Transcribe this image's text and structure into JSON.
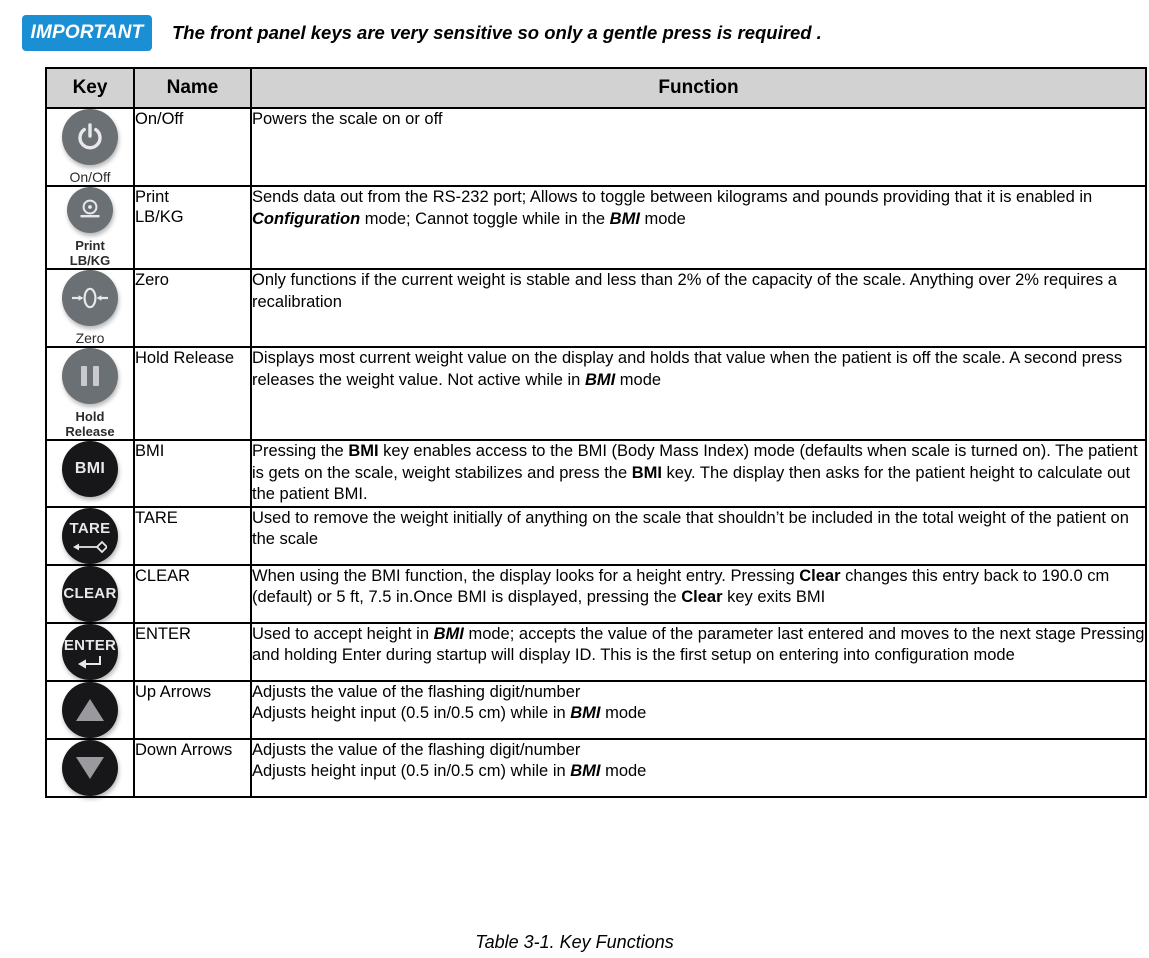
{
  "banner": {
    "tag": "IMPORTANT",
    "text": "The front panel keys are very sensitive so only a gentle press is required ."
  },
  "table": {
    "headers": {
      "key": "Key",
      "name": "Name",
      "function": "Function"
    },
    "rows": [
      {
        "icon": "power-icon",
        "key_label": "On/Off",
        "name": "On/Off",
        "function_parts": [
          {
            "t": "Powers the scale on or off",
            "s": "n"
          }
        ]
      },
      {
        "icon": "print-icon",
        "key_label": "Print\nLB/KG",
        "name": "Print\nLB/KG",
        "function_parts": [
          {
            "t": "Sends data out from the RS-232 port; Allows to toggle between kilograms and pounds providing that it is enabled in ",
            "s": "n"
          },
          {
            "t": "Configuration",
            "s": "bi"
          },
          {
            "t": " mode; Cannot toggle while in the ",
            "s": "n"
          },
          {
            "t": "BMI",
            "s": "bi"
          },
          {
            "t": " mode",
            "s": "n"
          }
        ]
      },
      {
        "icon": "zero-icon",
        "key_label": "Zero",
        "name": "Zero",
        "function_parts": [
          {
            "t": "Only functions if the current weight is stable and less than 2% of the capacity of the scale. Anything over 2% requires a recalibration",
            "s": "n"
          }
        ]
      },
      {
        "icon": "hold-release-icon",
        "key_label": "Hold\nRelease",
        "name": "Hold Release",
        "function_parts": [
          {
            "t": "Displays most current weight value on the display and holds that value when the patient is off the scale. A second press releases the weight value. Not active while in ",
            "s": "n"
          },
          {
            "t": "BMI",
            "s": "bi"
          },
          {
            "t": " mode",
            "s": "n"
          }
        ]
      },
      {
        "icon": "bmi-icon",
        "key_label": "",
        "name": "BMI",
        "function_parts": [
          {
            "t": "Pressing the ",
            "s": "n"
          },
          {
            "t": "BMI",
            "s": "b"
          },
          {
            "t": " key enables access to the BMI (Body Mass Index) mode (defaults when scale is turned on). The patient is gets on the scale, weight stabilizes and press the ",
            "s": "n"
          },
          {
            "t": "BMI",
            "s": "b"
          },
          {
            "t": " key. The display then asks for the patient height to calculate out the patient BMI.",
            "s": "n"
          }
        ]
      },
      {
        "icon": "tare-icon",
        "key_label": "",
        "name": "TARE",
        "function_parts": [
          {
            "t": "Used to remove the weight initially of anything on the scale that shouldn’t be included in the total weight of the patient on the scale",
            "s": "n"
          }
        ]
      },
      {
        "icon": "clear-icon",
        "key_label": "",
        "name": "CLEAR",
        "function_parts": [
          {
            "t": "When using the BMI function, the display looks for a height entry. Pressing ",
            "s": "n"
          },
          {
            "t": "Clear",
            "s": "b"
          },
          {
            "t": " changes this entry back to 190.0 cm (default) or 5 ft, 7.5 in.Once BMI is displayed, pressing the ",
            "s": "n"
          },
          {
            "t": "Clear",
            "s": "b"
          },
          {
            "t": " key exits BMI",
            "s": "n"
          }
        ]
      },
      {
        "icon": "enter-icon",
        "key_label": "",
        "name": "ENTER",
        "function_parts": [
          {
            "t": "Used to accept height in ",
            "s": "n"
          },
          {
            "t": "BMI",
            "s": "bi"
          },
          {
            "t": " mode; accepts the value of the parameter last entered and moves to the next stage Pressing and holding Enter during startup will display ID. This is the first setup on entering into configuration mode",
            "s": "n"
          }
        ]
      },
      {
        "icon": "arrow-up-icon",
        "key_label": "",
        "name": "Up Arrows",
        "function_parts": [
          {
            "t": "Adjusts the value of the flashing digit/number",
            "s": "n"
          },
          {
            "t": "",
            "s": "br"
          },
          {
            "t": "Adjusts height input (0.5 in/0.5 cm) while in ",
            "s": "n"
          },
          {
            "t": "BMI",
            "s": "bi"
          },
          {
            "t": " mode",
            "s": "n"
          }
        ]
      },
      {
        "icon": "arrow-down-icon",
        "key_label": "",
        "name": "Down Arrows",
        "function_parts": [
          {
            "t": "Adjusts the value of the flashing digit/number",
            "s": "n"
          },
          {
            "t": "",
            "s": "br"
          },
          {
            "t": "Adjusts height input (0.5 in/0.5 cm) while in ",
            "s": "n"
          },
          {
            "t": "BMI",
            "s": "bi"
          },
          {
            "t": " mode",
            "s": "n"
          }
        ]
      }
    ]
  },
  "caption": "Table 3-1.  Key Functions",
  "colors": {
    "banner_tag_bg": "#1b8fd4",
    "header_bg": "#d2d2d2",
    "key_gray": "#6b7075",
    "key_black": "#17171a",
    "glyph_light": "#e8e8ea"
  }
}
